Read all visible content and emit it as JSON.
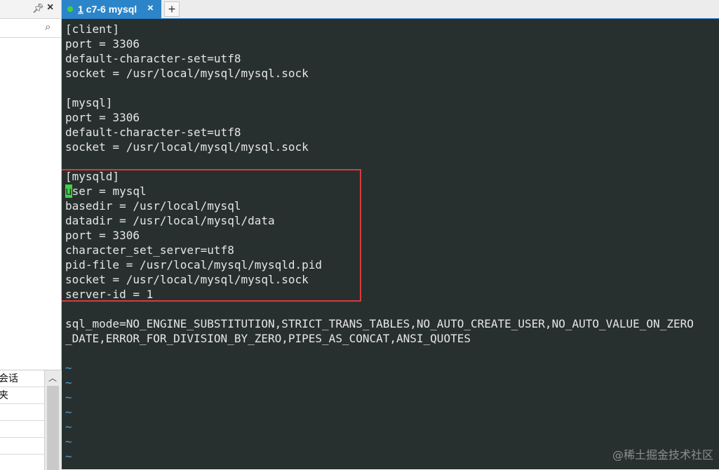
{
  "sidebar": {
    "rows": [
      {
        "label": "会话"
      },
      {
        "label": "夹"
      },
      {
        "label": ""
      },
      {
        "label": ""
      },
      {
        "label": ""
      }
    ]
  },
  "tab": {
    "number": "1",
    "title": "c7-6 mysql",
    "close": "×",
    "add": "+"
  },
  "terminal": {
    "lines": [
      "[client]",
      "port = 3306",
      "default-character-set=utf8",
      "socket = /usr/local/mysql/mysql.sock",
      "",
      "[mysql]",
      "port = 3306",
      "default-character-set=utf8",
      "socket = /usr/local/mysql/mysql.sock",
      "",
      "[mysqld]",
      "ser = mysql",
      "basedir = /usr/local/mysql",
      "datadir = /usr/local/mysql/data",
      "port = 3306",
      "character_set_server=utf8",
      "pid-file = /usr/local/mysql/mysqld.pid",
      "socket = /usr/local/mysql/mysql.sock",
      "server-id = 1",
      "",
      "sql_mode=NO_ENGINE_SUBSTITUTION,STRICT_TRANS_TABLES,NO_AUTO_CREATE_USER,NO_AUTO_VALUE_ON_ZERO",
      "_DATE,ERROR_FOR_DIVISION_BY_ZERO,PIPES_AS_CONCAT,ANSI_QUOTES",
      "",
      "~",
      "~",
      "~",
      "~",
      "~",
      "~",
      "~"
    ],
    "cursor_char": "u",
    "cursor_line_index": 11
  },
  "watermark": "@稀土掘金技术社区",
  "colors": {
    "terminal_bg": "#28302f",
    "tab_active": "#2c85c9",
    "highlight": "#d93a3a",
    "cursor": "#3fd43f",
    "tilde": "#4a9ed8"
  }
}
